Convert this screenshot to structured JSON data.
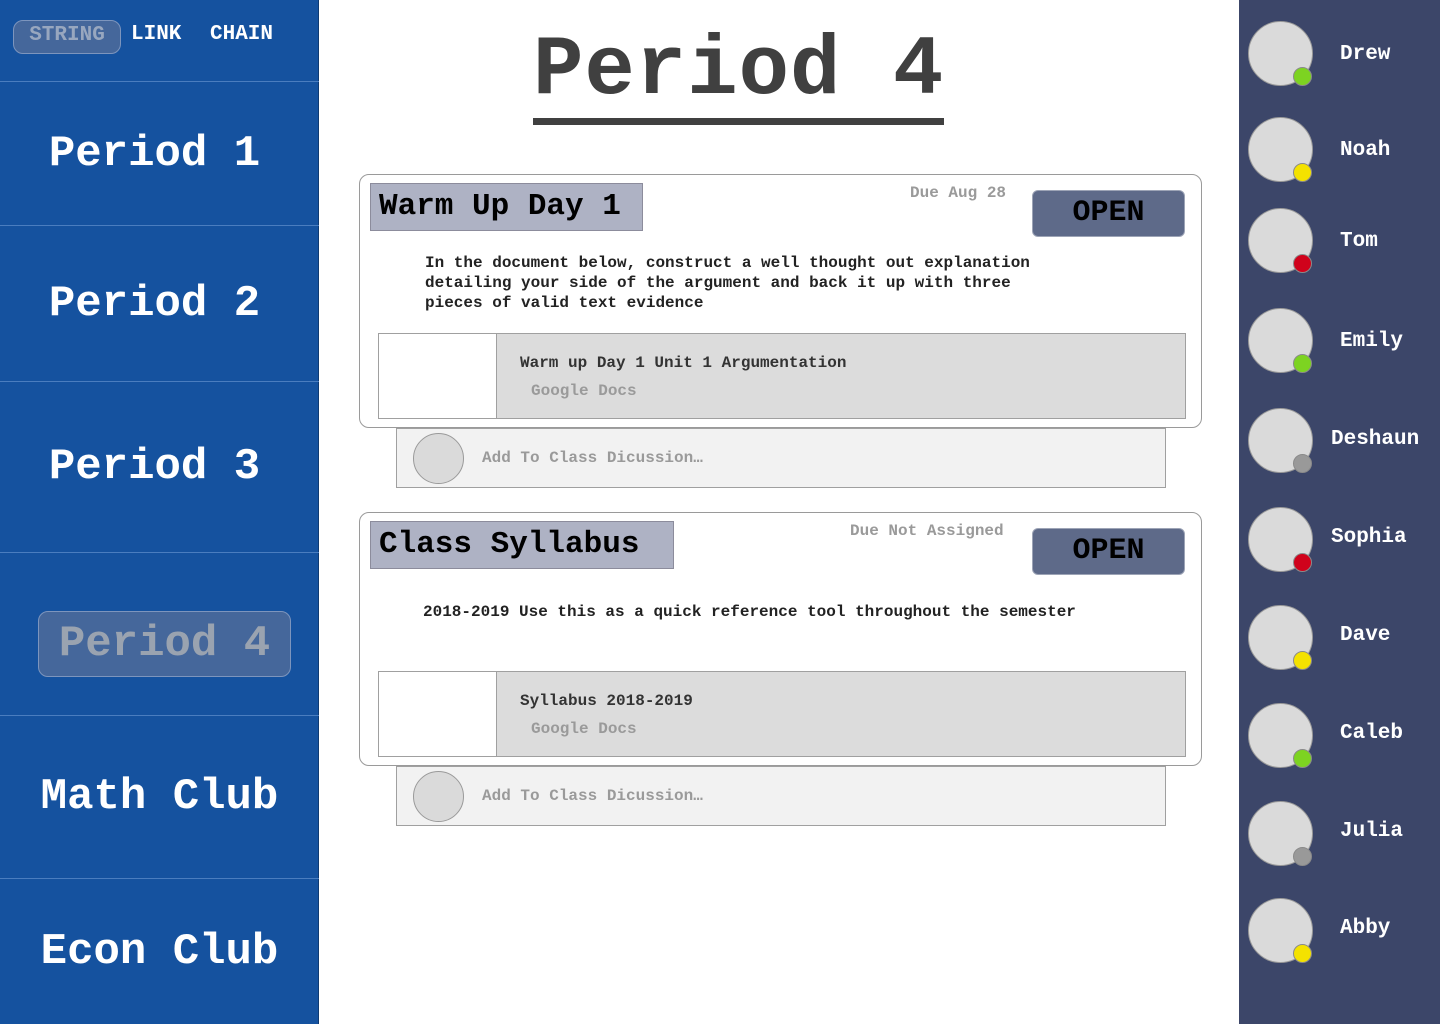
{
  "topnav": {
    "items": [
      {
        "label": "STRING",
        "active": true
      },
      {
        "label": "LINK",
        "active": false
      },
      {
        "label": "CHAIN",
        "active": false
      }
    ]
  },
  "sidebar": {
    "items": [
      {
        "label": "Period 1",
        "active": false
      },
      {
        "label": "Period 2",
        "active": false
      },
      {
        "label": "Period 3",
        "active": false
      },
      {
        "label": "Period 4",
        "active": true
      },
      {
        "label": "Math Club",
        "active": false
      },
      {
        "label": "Econ Club",
        "active": false
      }
    ]
  },
  "main": {
    "title": "Period 4",
    "assignments": [
      {
        "title": "Warm Up Day 1",
        "due": "Due Aug 28",
        "open_label": "OPEN",
        "description": "In the document below, construct a well thought out explanation\ndetailing your side of the argument and back it up with three\npieces of valid text evidence",
        "attachment": {
          "name": "Warm up Day 1 Unit 1 Argumentation",
          "type": "Google Docs"
        },
        "discussion_placeholder": "Add To Class Dicussion…"
      },
      {
        "title": "Class Syllabus",
        "due": "Due Not Assigned",
        "open_label": "OPEN",
        "description": "2018-2019 Use this as a quick reference tool throughout the semester",
        "attachment": {
          "name": "Syllabus 2018-2019",
          "type": "Google Docs"
        },
        "discussion_placeholder": "Add To Class Dicussion…"
      }
    ]
  },
  "roster": {
    "students": [
      {
        "name": "Drew",
        "status": "online",
        "status_color": "#7dd321"
      },
      {
        "name": "Noah",
        "status": "away",
        "status_color": "#f4e200"
      },
      {
        "name": "Tom",
        "status": "busy",
        "status_color": "#d0021b"
      },
      {
        "name": "Emily",
        "status": "online",
        "status_color": "#7dd321"
      },
      {
        "name": "Deshaun",
        "status": "offline",
        "status_color": "#999999"
      },
      {
        "name": "Sophia",
        "status": "busy",
        "status_color": "#d0021b"
      },
      {
        "name": "Dave",
        "status": "away",
        "status_color": "#f4e200"
      },
      {
        "name": "Caleb",
        "status": "online",
        "status_color": "#7dd321"
      },
      {
        "name": "Julia",
        "status": "offline",
        "status_color": "#999999"
      },
      {
        "name": "Abby",
        "status": "away",
        "status_color": "#f4e200"
      }
    ]
  },
  "colors": {
    "sidebar_bg": "#15529f",
    "roster_bg": "#3c4669",
    "title_color": "#404040",
    "card_title_bg": "#aeb2c4",
    "open_button_bg": "#5e6a89"
  }
}
